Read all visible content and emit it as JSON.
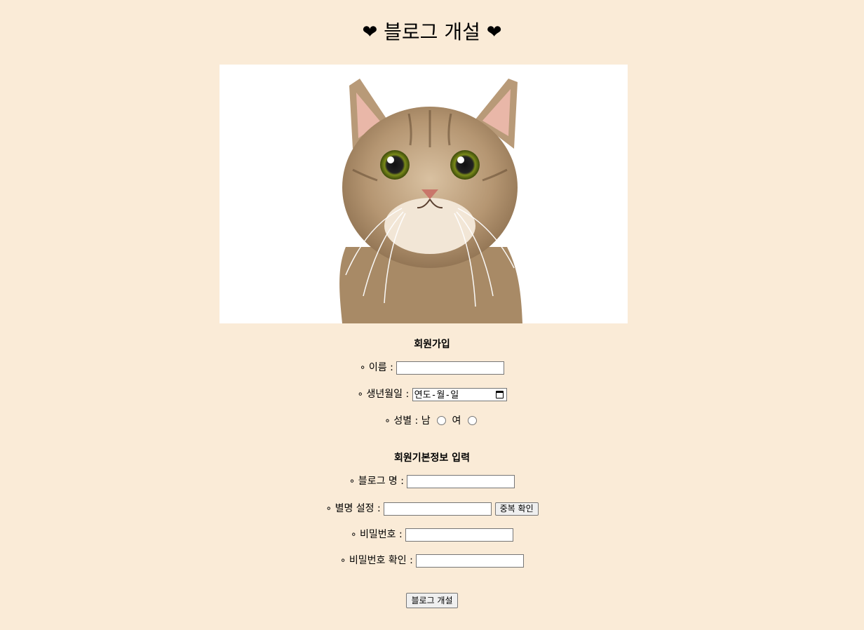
{
  "title": {
    "heart_left": "❤",
    "text": "블로그 개설",
    "heart_right": "❤"
  },
  "signup_section": {
    "heading": "회원가입",
    "name_label": "∘ 이름 :",
    "birth_label": "∘ 생년월일 :",
    "birth_value": "연도-월-일",
    "gender_label": "∘ 성별 : 남",
    "gender_female": "여"
  },
  "basic_info_section": {
    "heading": "회원기본정보 입력",
    "blog_name_label": "∘ 블로그 명 :",
    "nickname_label": "∘ 별명 설정 :",
    "dup_check_button": "중복 확인",
    "password_label": "∘ 비밀번호 :",
    "password_confirm_label": "∘ 비밀번호 확인 :"
  },
  "submit_button": "블로그 개설",
  "colors": {
    "background": "#faebd7"
  }
}
